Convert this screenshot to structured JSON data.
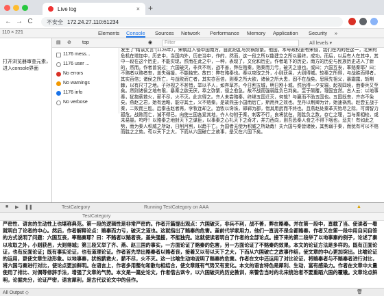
{
  "browser": {
    "tab_title": "Live log",
    "new_tab": "+",
    "nav": {
      "back": "←",
      "forward": "→",
      "reload": "C"
    },
    "security": "不安全",
    "url": "172.24.27.110:61234"
  },
  "devtools": {
    "viewport_w": "110",
    "viewport_x": "×",
    "viewport_h": "221",
    "tabs": [
      "Elements",
      "Console",
      "Sources",
      "Network",
      "Performance",
      "Memory",
      "Application",
      "Security"
    ],
    "more": "»"
  },
  "page": {
    "instruction": "打开浏览器审查元素，进入console界面"
  },
  "console": {
    "context": "top",
    "filter_placeholder": "Filter",
    "levels": "All levels ▾",
    "sidebar": [
      {
        "label": "1176 mess...",
        "icon": "list-icon"
      },
      {
        "label": "1176 user ...",
        "icon": "user-icon"
      },
      {
        "label": "No errors",
        "icon": "error-icon"
      },
      {
        "label": "No warnings",
        "icon": "warning-icon"
      },
      {
        "label": "1176 info",
        "icon": "info-icon"
      },
      {
        "label": "No verbose",
        "icon": "verbose-icon"
      }
    ],
    "text": "发生了\"精读文言\"(1126年），宋朝廷入侵中国南方，自此纷乱与灾祸频繁。他国，本号政权更有宋侵，我们在内的在这一，北宋的危机在增加中，历史中，当国内外，历史当中，作的，然而，这一段之所以能建立之所以最终，成功，而后，以后有人在其中，其中一段在这个历史，不能实现，然而在此之中，一种，表现了，文化和历史。作者笔下的历史，南方的历史与民族历史进入了新的，然而。作者曾说过：六国破灭，非兵不利，战不善，弊在赂秦。赂秦而力亏，破灭之道也。或曰：六国互丧，率赂秦耶？曰：不赂者以赂者丧，盖失强援，不能独完。故曰：弊在赂秦也。秦以攻取之外，小则获邑，大则得城。较秦之所得，与战胜而得者，其实百倍；诸侯之所亡，与战败而亡者，其实亦百倍。则秦之所大欲，诸侯之所大患，固不在战矣。思厥先祖父，暴霜露，斩荆棘，以有尺寸之地。子孙视之不甚惜，举以予人，如弃草芥。今日割五城，明日割十城，然后得一夕安寝。起视四境，而秦兵又至矣。然则诸侯之地有限，暴秦之欲无厌，奉之弥繁，侵之愈急。故不战而强弱胜负已判矣。至于颠覆，理固宜然。古人云：以地事秦，犹抱薪救火，薪不尽，火不灭。此言得之。齐人未尝赂秦，终继五国迁灭，何哉？与嬴而不助五国也。五国既丧，齐亦不免矣。燕赵之君，始有远略，能守其土，义不赂秦。是故燕虽小国而后亡，斯用兵之效也。至丹以荆卿为计，始速祸焉。赵尝五战于秦，二败而三胜。后秦击赵者再，李牧连却之。洎牧以谗诛，邯郸为郡，惜其用武而不终也。且燕赵处秦革灭殆尽之际，可谓智力孤危，战败而亡，诚不得已。向使三国各爱其地，齐人勿附于秦，刺客不行，良将犹在，则胜负之数，存亡之理，当与秦相较，或未易量。呜呼！以赂秦之地封天下之谋臣，以事秦之心礼天下之奇才，并力西向，则吾恐秦人食之不得下咽也。悲夫！有如此之势，而为秦人积威之所劫，日削月割，以趋于亡。为国者无使为积威之所劫哉！夫六国与秦皆诸侯，其势弱于秦，而犹有可以不赂而胜之之势。苟以天下之大，下而从六国破亡之故事，是又在六国下矣。"
  },
  "ide": {
    "run_label": "Running TestCategory on AAA",
    "tab_label": "TestCategory",
    "tab2_label": "TestCategory",
    "text": "严密性、语言的生动性上也堪称典范。第一段的逻辑性是非常严密的。作者开篇提出观点：六国破灭，非兵不利，战不善，弊在赂秦。并在第一段中，直截了当、使读者一看就明白了论者的中心。然后，作者解释论点：赂秦而力亏，破灭之道也。这就指出了赂秦的危害。盖前代学家用力，他们一直说不是全都赂秦，作者又在第一段中用自问自答的方式说明了问题：六国互丧，率赂秦耶？曰：不赂者以赂者丧，盖失强援，不能独完。这就使读者明白了作者的全部论点。接下来的第二段举了以地事秦的例子，论述了秦以攻取之外，小则获邑，大则得城；第三段又举了齐、燕、赵三国的事实，一方面论证了赂秦的危害，另一方面论证了不赂秦的效果。本文的论证方法是多样的。既有正面论证，也有反面论证；既有事实论证，也有道理论证。作者首先举出赂秦者以赂者丧，接着又以苟以天下之大，下而从六国破亡之故事作结，使文章的中心更加突出。比喻论证的运用，更使文章生动形象。以地事秦，犹抱薪救火，薪不尽，火不灭。这一比喻生动地说明了赂秦的危害。作者在文中还运用了对比论证，将赂秦者与不赂秦者进行对比，将六国与秦进行对比，使论点更加鲜明。在语言上，作者多用整句和散句相结合，使文章既有气势又有变化。本文的语言特色是犀利、生动，富有感染力。作者在文章中大量使用了排比、对偶等修辞手法，增强了文章的气势。本文是一篇史论文，作者借古讽今，以六国破灭的历史教训，来警告当时的北宋统治者不要重蹈六国的覆辙。文章论点鲜明，论据充分，论证严密，语言犀利，是古代议论文中的佳作。",
    "status": "All Output ◇"
  }
}
